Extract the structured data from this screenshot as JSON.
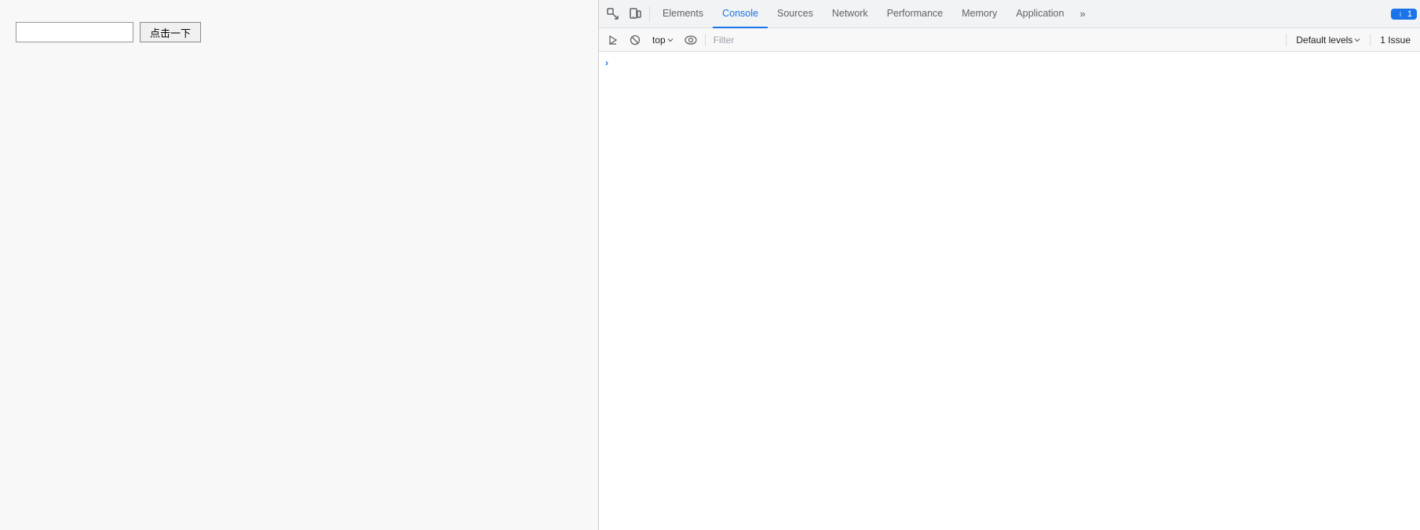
{
  "page": {
    "input_placeholder": "",
    "button_label": "点击一下"
  },
  "devtools": {
    "tabs": [
      {
        "id": "elements",
        "label": "Elements",
        "active": false
      },
      {
        "id": "console",
        "label": "Console",
        "active": true
      },
      {
        "id": "sources",
        "label": "Sources",
        "active": false
      },
      {
        "id": "network",
        "label": "Network",
        "active": false
      },
      {
        "id": "performance",
        "label": "Performance",
        "active": false
      },
      {
        "id": "memory",
        "label": "Memory",
        "active": false
      },
      {
        "id": "application",
        "label": "Application",
        "active": false
      }
    ],
    "more_tabs_label": "»",
    "issues_badge": "1",
    "console_toolbar": {
      "top_label": "top",
      "filter_placeholder": "Filter",
      "default_levels_label": "Default levels",
      "issues_label": "1 Issue"
    }
  }
}
